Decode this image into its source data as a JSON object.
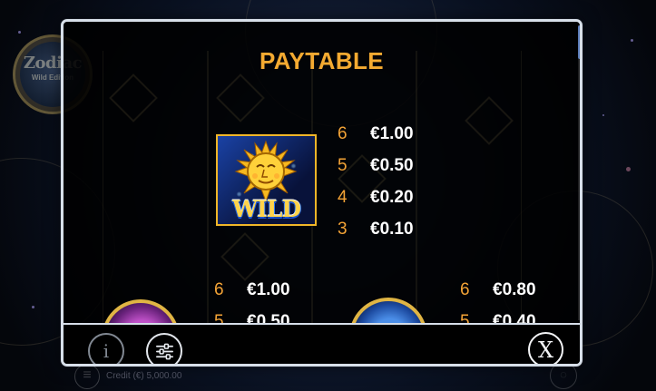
{
  "background": {
    "logo": {
      "title": "Zodiac",
      "edition": "Wild Edition"
    },
    "footer": {
      "credit": "Credit (€) 5,000.00"
    }
  },
  "paytable": {
    "title": "PAYTABLE",
    "wild": {
      "label": "WILD",
      "icon": "sun-wild-icon",
      "pays": [
        {
          "count": "6",
          "value": "€1.00"
        },
        {
          "count": "5",
          "value": "€0.50"
        },
        {
          "count": "4",
          "value": "€0.20"
        },
        {
          "count": "3",
          "value": "€0.10"
        }
      ]
    },
    "lower_left": {
      "icon": "zodiac-purple-icon",
      "glyph": "♈",
      "pays": [
        {
          "count": "6",
          "value": "€1.00"
        },
        {
          "count": "5",
          "value": "€0.50"
        }
      ]
    },
    "lower_right": {
      "icon": "zodiac-blue-icon",
      "glyph": "♋",
      "pays": [
        {
          "count": "6",
          "value": "€0.80"
        },
        {
          "count": "5",
          "value": "€0.40"
        }
      ]
    }
  },
  "controls": {
    "info_label": "i",
    "settings_icon": "sliders-icon",
    "close_label": "X"
  },
  "colors": {
    "title": "#f4aa31",
    "count": "#f3a336",
    "value": "#ffffff",
    "border": "#d7dfe9",
    "scrollbar": "#5c7dba"
  }
}
